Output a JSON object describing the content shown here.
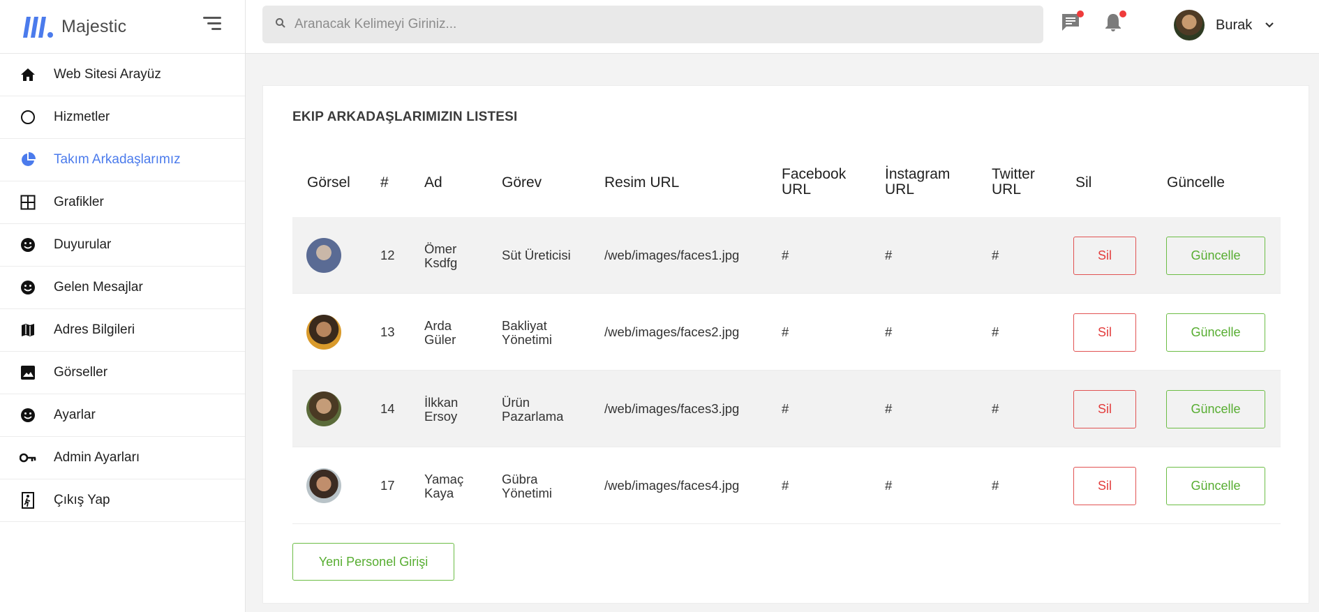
{
  "brand": {
    "name": "Majestic",
    "color": "#4b7bec"
  },
  "sidebar": {
    "items": [
      {
        "label": "Web Sitesi Arayüz",
        "icon": "home-icon"
      },
      {
        "label": "Hizmetler",
        "icon": "circle-icon"
      },
      {
        "label": "Takım Arkadaşlarımız",
        "icon": "pie-chart-icon",
        "active": true
      },
      {
        "label": "Grafikler",
        "icon": "grid-icon"
      },
      {
        "label": "Duyurular",
        "icon": "smiley-icon"
      },
      {
        "label": "Gelen Mesajlar",
        "icon": "smiley-icon"
      },
      {
        "label": "Adres Bilgileri",
        "icon": "map-icon"
      },
      {
        "label": "Görseller",
        "icon": "image-icon"
      },
      {
        "label": "Ayarlar",
        "icon": "smiley-icon"
      },
      {
        "label": "Admin Ayarları",
        "icon": "key-icon"
      },
      {
        "label": "Çıkış Yap",
        "icon": "exit-icon"
      }
    ]
  },
  "topbar": {
    "search_placeholder": "Aranacak Kelimeyi Giriniz...",
    "user_name": "Burak",
    "notification_color": "#ef3b3b"
  },
  "main": {
    "title": "EKIP ARKADAŞLARIMIZIN LISTESI",
    "columns": [
      "Görsel",
      "#",
      "Ad",
      "Görev",
      "Resim URL",
      "Facebook URL",
      "İnstagram URL",
      "Twitter URL",
      "Sil",
      "Güncelle"
    ],
    "rows": [
      {
        "id": "12",
        "name": "Ömer Ksdfg",
        "role": "Süt Üreticisi",
        "image_url": "/web/images/faces1.jpg",
        "facebook": "#",
        "instagram": "#",
        "twitter": "#",
        "delete_label": "Sil",
        "update_label": "Güncelle"
      },
      {
        "id": "13",
        "name": "Arda Güler",
        "role": "Bakliyat Yönetimi",
        "image_url": "/web/images/faces2.jpg",
        "facebook": "#",
        "instagram": "#",
        "twitter": "#",
        "delete_label": "Sil",
        "update_label": "Güncelle"
      },
      {
        "id": "14",
        "name": "İlkkan Ersoy",
        "role": "Ürün Pazarlama",
        "image_url": "/web/images/faces3.jpg",
        "facebook": "#",
        "instagram": "#",
        "twitter": "#",
        "delete_label": "Sil",
        "update_label": "Güncelle"
      },
      {
        "id": "17",
        "name": "Yamaç Kaya",
        "role": "Gübra Yönetimi",
        "image_url": "/web/images/faces4.jpg",
        "facebook": "#",
        "instagram": "#",
        "twitter": "#",
        "delete_label": "Sil",
        "update_label": "Güncelle"
      }
    ],
    "new_button_label": "Yeni Personel Girişi",
    "delete_color": "#e33c3c",
    "update_color": "#57ad31"
  }
}
